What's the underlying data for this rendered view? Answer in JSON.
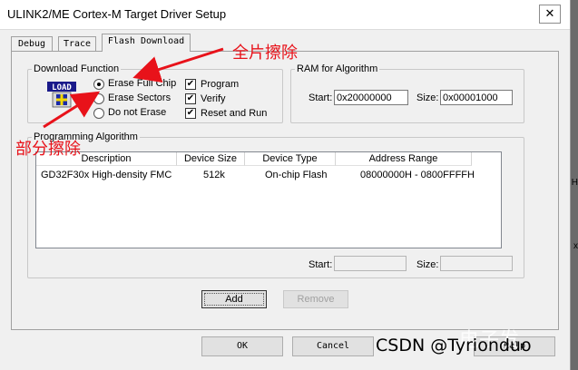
{
  "window": {
    "title": "ULINK2/ME Cortex-M Target Driver Setup",
    "close_glyph": "✕"
  },
  "tabs": [
    {
      "label": "Debug",
      "active": false
    },
    {
      "label": "Trace",
      "active": false
    },
    {
      "label": "Flash Download",
      "active": true
    }
  ],
  "download_function": {
    "legend": "Download Function",
    "icon_text": "LOAD",
    "erase_options": [
      {
        "label": "Erase Full Chip",
        "selected": true
      },
      {
        "label": "Erase Sectors",
        "selected": false
      },
      {
        "label": "Do not Erase",
        "selected": false
      }
    ],
    "actions": [
      {
        "label": "Program",
        "checked": true
      },
      {
        "label": "Verify",
        "checked": true
      },
      {
        "label": "Reset and Run",
        "checked": true
      }
    ]
  },
  "ram_for_algorithm": {
    "legend": "RAM for Algorithm",
    "start_label": "Start:",
    "start_value": "0x20000000",
    "size_label": "Size:",
    "size_value": "0x00001000"
  },
  "programming_algorithm": {
    "legend": "Programming Algorithm",
    "columns": [
      "Description",
      "Device Size",
      "Device Type",
      "Address Range"
    ],
    "rows": [
      {
        "description": "GD32F30x High-density FMC",
        "device_size": "512k",
        "device_type": "On-chip Flash",
        "address_range": "08000000H - 0800FFFFH"
      }
    ],
    "start_label": "Start:",
    "size_label": "Size:"
  },
  "buttons": {
    "add": "Add",
    "remove": "Remove",
    "ok": "OK",
    "cancel": "Cancel",
    "help": "Help"
  },
  "annotations": {
    "full_chip": "全片擦除",
    "sector": "部分擦除"
  },
  "watermark": {
    "csdn": "CSDN @Tyrionduo",
    "site": "电子发"
  },
  "colors": {
    "annotation_red": "#e8121a"
  },
  "side_chars": [
    "H",
    "x"
  ]
}
